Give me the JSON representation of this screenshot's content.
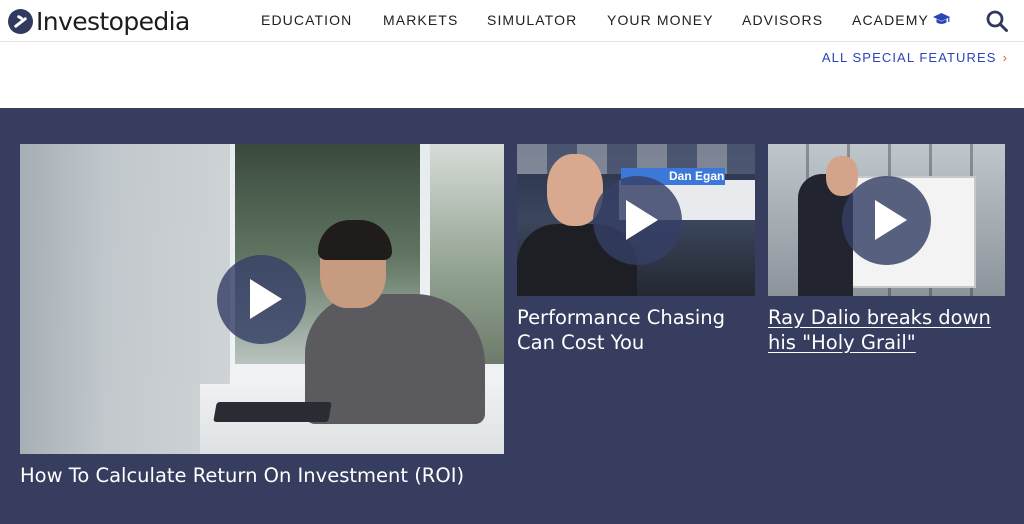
{
  "header": {
    "logo_text": "Investopedia",
    "nav": [
      {
        "label": "EDUCATION"
      },
      {
        "label": "MARKETS"
      },
      {
        "label": "SIMULATOR"
      },
      {
        "label": "YOUR MONEY"
      },
      {
        "label": "ADVISORS"
      },
      {
        "label": "ACADEMY"
      }
    ],
    "academy_icon": "graduation-cap-icon",
    "search_icon": "search-icon"
  },
  "special_features": {
    "label": "ALL SPECIAL FEATURES",
    "chevron": "›"
  },
  "videos": [
    {
      "title": "How To Calculate Return On Investment (ROI)",
      "icon": "play-icon"
    },
    {
      "title": "Performance Chasing Can Cost You",
      "icon": "play-icon",
      "overlay_name": "Dan Egan"
    },
    {
      "title": "Ray Dalio breaks down his \"Holy Grail\"",
      "icon": "play-icon"
    }
  ],
  "colors": {
    "band": "#363d5e",
    "link": "#2b44b8",
    "chevron": "#e15a4a",
    "logo": "#2f3a5e"
  }
}
